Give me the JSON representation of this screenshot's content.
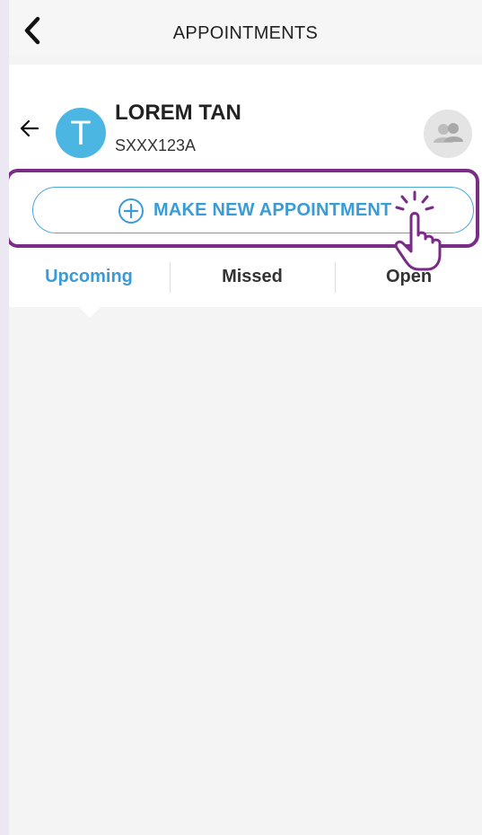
{
  "header": {
    "title": "APPOINTMENTS"
  },
  "profile": {
    "name": "LOREM TAN",
    "id": "SXXX123A",
    "avatar_letter": "T"
  },
  "actions": {
    "make_appointment_label": "MAKE NEW APPOINTMENT"
  },
  "tabs": [
    {
      "label": "Upcoming",
      "active": true
    },
    {
      "label": "Missed",
      "active": false
    },
    {
      "label": "Open",
      "active": false
    }
  ],
  "icons": {
    "nav_back": "chevron-left-icon",
    "profile_back": "arrow-left-icon",
    "group": "group-icon",
    "plus": "plus-circle-icon",
    "hand": "pointer-hand-icon"
  },
  "colors": {
    "accent": "#3a9bd5",
    "avatar": "#4cb6e3",
    "highlight": "#7a2c86"
  }
}
